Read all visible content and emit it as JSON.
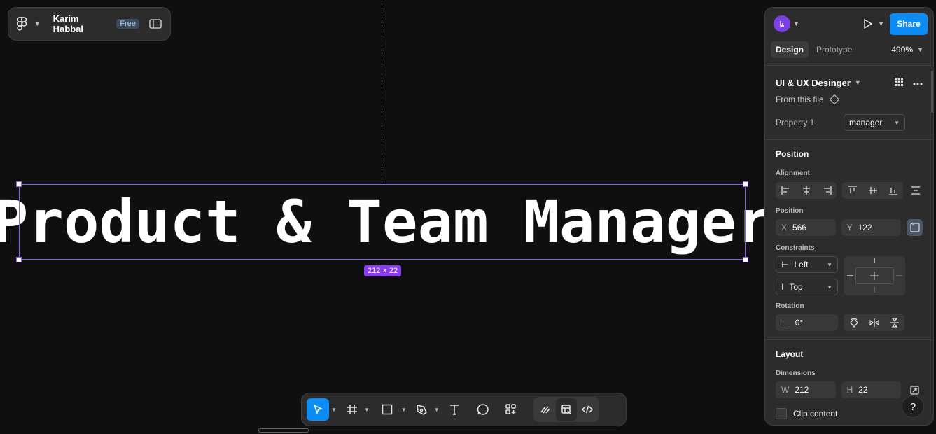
{
  "file": {
    "name": "Karim Habbal",
    "plan_badge": "Free"
  },
  "canvas": {
    "text": "Product & Team Manager",
    "selection_size": "212 × 22"
  },
  "toolbar": {
    "tools": [
      "move-tool",
      "frame-tool",
      "shape-tool",
      "pen-tool",
      "text-tool",
      "comment-tool",
      "actions-tool",
      "draw-mode",
      "design-mode",
      "dev-mode"
    ]
  },
  "panel": {
    "share_label": "Share",
    "tabs": [
      {
        "label": "Design",
        "active": true
      },
      {
        "label": "Prototype",
        "active": false
      }
    ],
    "zoom": "490%",
    "component": {
      "name": "UI & UX Desinger",
      "source": "From this file",
      "property_label": "Property 1",
      "property_value": "manager"
    },
    "position": {
      "title": "Position",
      "alignment_label": "Alignment",
      "position_label": "Position",
      "x_prefix": "X",
      "x": "566",
      "y_prefix": "Y",
      "y": "122",
      "constraints_label": "Constraints",
      "constraint_h": "Left",
      "constraint_v": "Top",
      "rotation_label": "Rotation",
      "rotation": "0°"
    },
    "layout": {
      "title": "Layout",
      "dimensions_label": "Dimensions",
      "w_prefix": "W",
      "w": "212",
      "h_prefix": "H",
      "h": "22",
      "clip_label": "Clip content"
    },
    "help": "?"
  },
  "colors": {
    "accent": "#0d8cf5",
    "selection": "#8b5cf6",
    "canvas": "#0f0f10",
    "panel": "#2c2c2c"
  }
}
